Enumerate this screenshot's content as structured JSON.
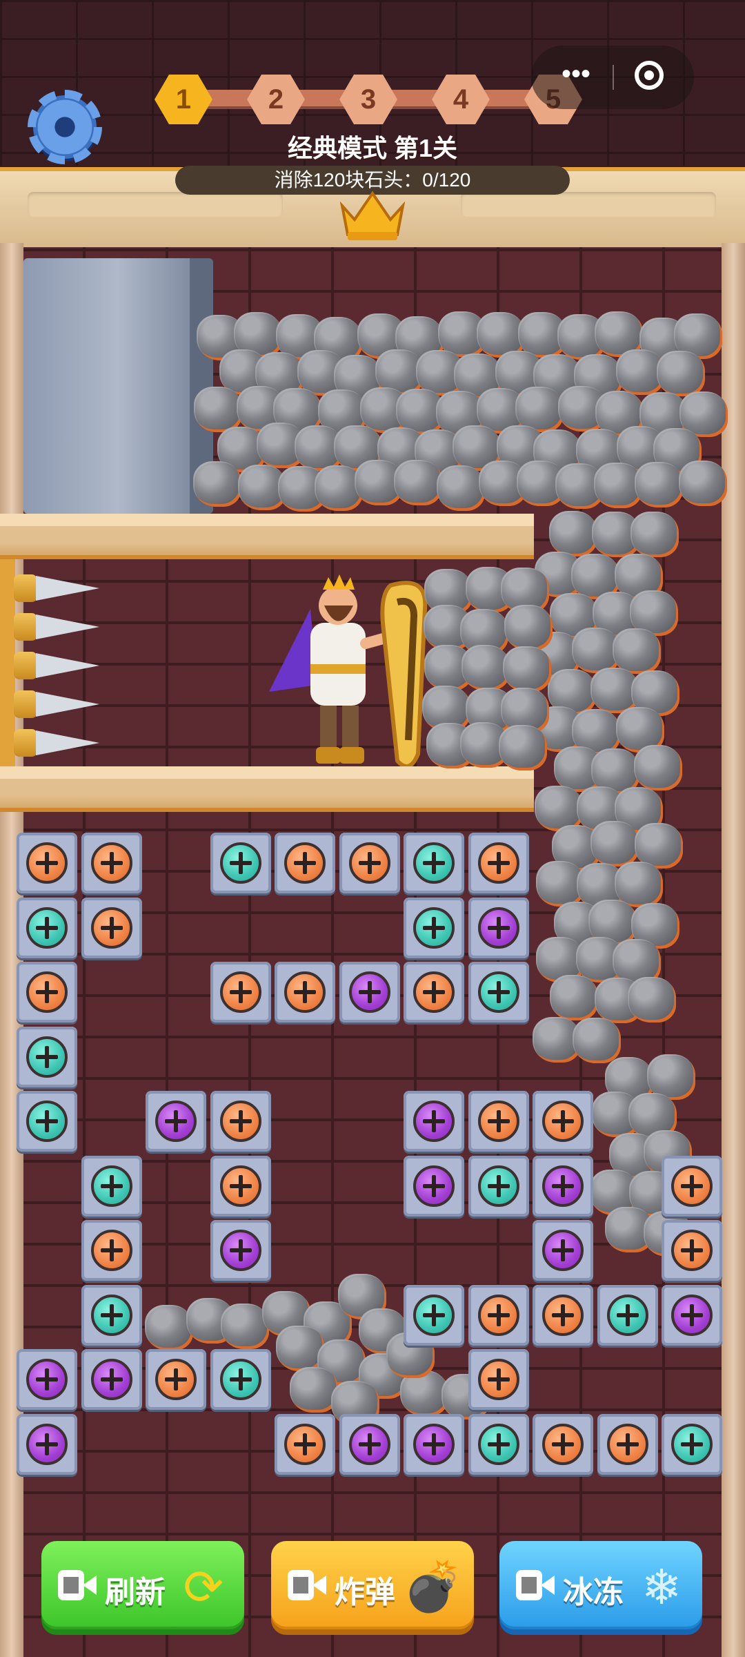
{
  "top_bar": {
    "levels": [
      "1",
      "2",
      "3",
      "4",
      "5"
    ],
    "current_level_index": 0,
    "mode_title": "经典模式 第1关",
    "objective": "消除120块石头：0/120",
    "menu_dots": "•••"
  },
  "colors": {
    "orange_screw": "#f08346",
    "teal_screw": "#3fc5b3",
    "purple_screw": "#a33fd4",
    "tile": "#aeb8d2",
    "wall": "#5a2a30"
  },
  "icons": {
    "settings": "gear-icon",
    "crown": "crown-icon",
    "video": "video-camera-icon",
    "refresh": "refresh-arrows-icon",
    "bomb": "bomb-icon",
    "freeze": "snowflake-icon"
  },
  "tiles": [
    {
      "row": 0,
      "col": 0,
      "color": "orange"
    },
    {
      "row": 0,
      "col": 1,
      "color": "orange"
    },
    {
      "row": 0,
      "col": 3,
      "color": "teal"
    },
    {
      "row": 0,
      "col": 4,
      "color": "orange"
    },
    {
      "row": 0,
      "col": 5,
      "color": "orange"
    },
    {
      "row": 0,
      "col": 6,
      "color": "teal"
    },
    {
      "row": 0,
      "col": 7,
      "color": "orange"
    },
    {
      "row": 1,
      "col": 0,
      "color": "teal"
    },
    {
      "row": 1,
      "col": 1,
      "color": "orange"
    },
    {
      "row": 1,
      "col": 6,
      "color": "teal"
    },
    {
      "row": 1,
      "col": 7,
      "color": "purple"
    },
    {
      "row": 2,
      "col": 0,
      "color": "orange"
    },
    {
      "row": 2,
      "col": 3,
      "color": "orange"
    },
    {
      "row": 2,
      "col": 4,
      "color": "orange"
    },
    {
      "row": 2,
      "col": 5,
      "color": "purple"
    },
    {
      "row": 2,
      "col": 6,
      "color": "orange"
    },
    {
      "row": 2,
      "col": 7,
      "color": "teal"
    },
    {
      "row": 3,
      "col": 0,
      "color": "teal"
    },
    {
      "row": 4,
      "col": 0,
      "color": "teal"
    },
    {
      "row": 4,
      "col": 2,
      "color": "purple"
    },
    {
      "row": 4,
      "col": 3,
      "color": "orange"
    },
    {
      "row": 4,
      "col": 6,
      "color": "purple"
    },
    {
      "row": 4,
      "col": 7,
      "color": "orange"
    },
    {
      "row": 4,
      "col": 8,
      "color": "orange"
    },
    {
      "row": 5,
      "col": 1,
      "color": "teal"
    },
    {
      "row": 5,
      "col": 3,
      "color": "orange"
    },
    {
      "row": 5,
      "col": 6,
      "color": "purple"
    },
    {
      "row": 5,
      "col": 7,
      "color": "teal"
    },
    {
      "row": 5,
      "col": 8,
      "color": "purple"
    },
    {
      "row": 5,
      "col": 10,
      "color": "orange"
    },
    {
      "row": 6,
      "col": 1,
      "color": "orange"
    },
    {
      "row": 6,
      "col": 3,
      "color": "purple"
    },
    {
      "row": 6,
      "col": 8,
      "color": "purple"
    },
    {
      "row": 6,
      "col": 10,
      "color": "orange"
    },
    {
      "row": 7,
      "col": 1,
      "color": "teal"
    },
    {
      "row": 7,
      "col": 6,
      "color": "teal"
    },
    {
      "row": 7,
      "col": 7,
      "color": "orange"
    },
    {
      "row": 7,
      "col": 8,
      "color": "orange"
    },
    {
      "row": 7,
      "col": 9,
      "color": "teal"
    },
    {
      "row": 7,
      "col": 10,
      "color": "purple"
    },
    {
      "row": 8,
      "col": 0,
      "color": "purple"
    },
    {
      "row": 8,
      "col": 1,
      "color": "purple"
    },
    {
      "row": 8,
      "col": 2,
      "color": "orange"
    },
    {
      "row": 8,
      "col": 3,
      "color": "teal"
    },
    {
      "row": 8,
      "col": 7,
      "color": "orange"
    },
    {
      "row": 9,
      "col": 0,
      "color": "purple"
    },
    {
      "row": 9,
      "col": 4,
      "color": "orange"
    },
    {
      "row": 9,
      "col": 5,
      "color": "purple"
    },
    {
      "row": 9,
      "col": 6,
      "color": "purple"
    },
    {
      "row": 9,
      "col": 7,
      "color": "teal"
    },
    {
      "row": 9,
      "col": 8,
      "color": "orange"
    },
    {
      "row": 9,
      "col": 9,
      "color": "orange"
    },
    {
      "row": 9,
      "col": 10,
      "color": "teal"
    }
  ],
  "buttons": [
    {
      "label": "刷新",
      "variant": "green",
      "icon": "refresh-arrows-icon"
    },
    {
      "label": "炸弹",
      "variant": "orange",
      "icon": "bomb-icon"
    },
    {
      "label": "冰冻",
      "variant": "blue",
      "icon": "snowflake-icon"
    }
  ]
}
